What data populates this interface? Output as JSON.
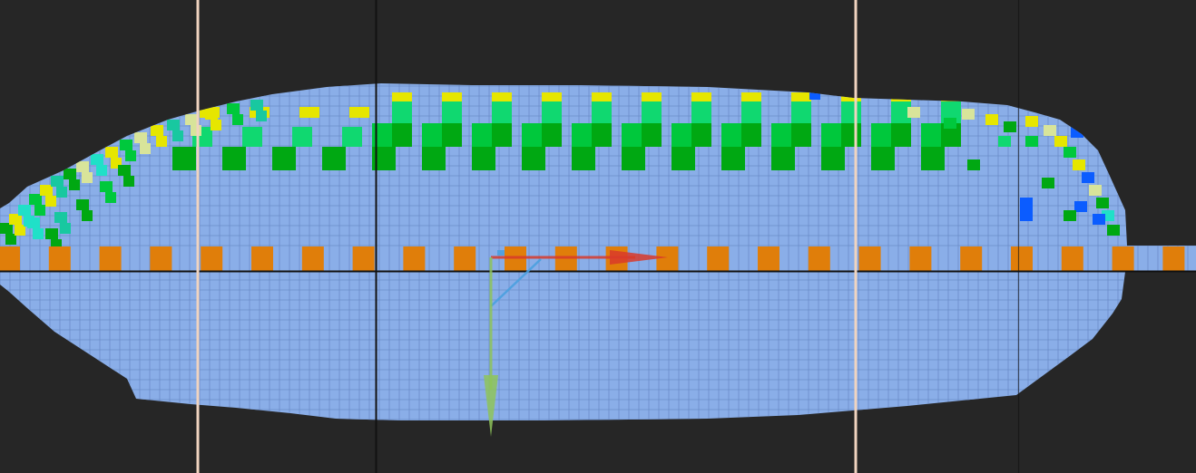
{
  "viewport": {
    "background": "#262626",
    "palette": {
      "voxel_default": "#8aaee8",
      "voxel_grid_line": "#6b8cc8",
      "voxel_orange": "#e07e0a",
      "voxel_green_dark": "#00a812",
      "voxel_green_mid": "#00c83c",
      "voxel_green_light": "#10d870",
      "voxel_teal": "#18c8a0",
      "voxel_cyan": "#20e0c8",
      "voxel_yellow": "#e6e600",
      "voxel_pale_yellow": "#d8e49a",
      "voxel_blue": "#0b5cff",
      "guide_line_peach": "#f0d4c0",
      "guide_line_black": "#111111"
    }
  },
  "axes_gizmo": {
    "x_axis_icon": "red-arrow",
    "y_axis_icon": "green-arrow",
    "z_axis_icon": "blue-line",
    "colors": {
      "x": "#d83a2a",
      "y": "#8ec45a",
      "z": "#4aa0e0"
    }
  }
}
